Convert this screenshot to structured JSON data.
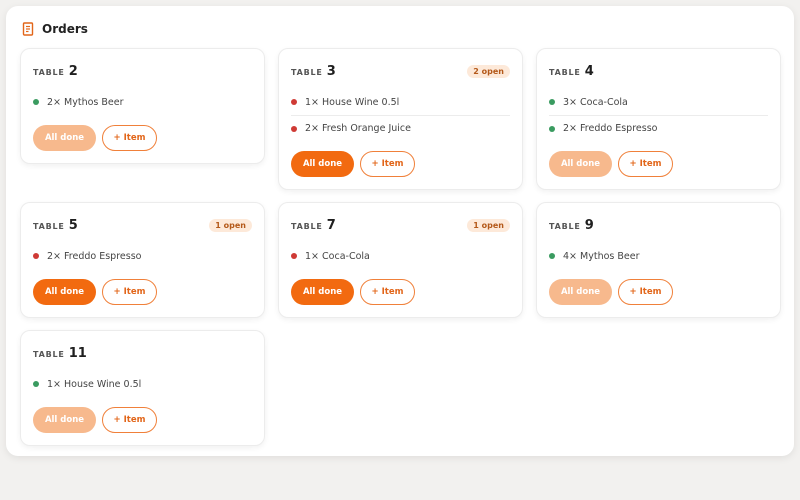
{
  "header": {
    "title": "Orders",
    "icon": "receipt-icon"
  },
  "labels": {
    "table": "TABLE",
    "all_done": "All done",
    "add_item": "+ Item"
  },
  "colors": {
    "accent": "#f26a10",
    "accent_muted": "#f7b98d",
    "status_done": "#3a9b60",
    "status_open": "#cf3a35"
  },
  "tables": [
    {
      "number": "2",
      "open_badge": "",
      "active": false,
      "items": [
        {
          "text": "2× Mythos Beer",
          "status": "done"
        }
      ]
    },
    {
      "number": "3",
      "open_badge": "2 open",
      "active": true,
      "items": [
        {
          "text": "1× House Wine 0.5l",
          "status": "open"
        },
        {
          "text": "2× Fresh Orange Juice",
          "status": "open"
        }
      ]
    },
    {
      "number": "4",
      "open_badge": "",
      "active": false,
      "items": [
        {
          "text": "3× Coca-Cola",
          "status": "done"
        },
        {
          "text": "2× Freddo Espresso",
          "status": "done"
        }
      ]
    },
    {
      "number": "5",
      "open_badge": "1 open",
      "active": true,
      "items": [
        {
          "text": "2× Freddo Espresso",
          "status": "open"
        }
      ]
    },
    {
      "number": "7",
      "open_badge": "1 open",
      "active": true,
      "items": [
        {
          "text": "1× Coca-Cola",
          "status": "open"
        }
      ]
    },
    {
      "number": "9",
      "open_badge": "",
      "active": false,
      "items": [
        {
          "text": "4× Mythos Beer",
          "status": "done"
        }
      ]
    },
    {
      "number": "11",
      "open_badge": "",
      "active": false,
      "items": [
        {
          "text": "1× House Wine 0.5l",
          "status": "done"
        }
      ]
    }
  ]
}
